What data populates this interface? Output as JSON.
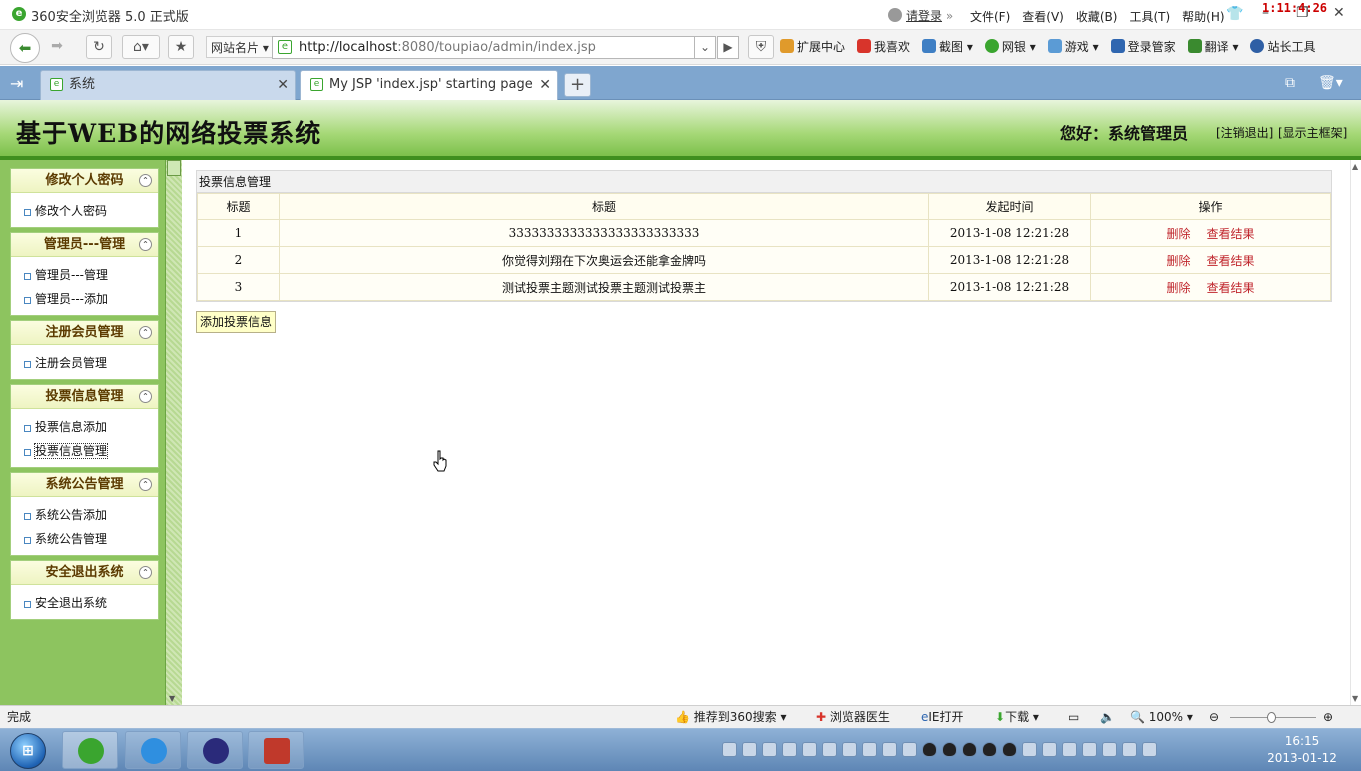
{
  "window": {
    "title": "360安全浏览器 5.0 正式版",
    "login_label": "请登录",
    "menu": [
      "文件(F)",
      "查看(V)",
      "收藏(B)",
      "工具(T)",
      "帮助(H)"
    ],
    "overlay_clock": "1:11:4:26",
    "minimize": "–",
    "restore": "❐",
    "close": "✕"
  },
  "navbar": {
    "site_cards": "网站名片 ▾",
    "url_host": "http://localhost",
    "url_rest": ":8080/toupiao/admin/index.jsp",
    "tools": [
      "扩展中心",
      "我喜欢",
      "截图",
      "网银",
      "游戏",
      "登录管家",
      "翻译",
      "站长工具"
    ]
  },
  "tabs": [
    {
      "label": "系统"
    },
    {
      "label": "My JSP 'index.jsp' starting page"
    }
  ],
  "header": {
    "site_title": "基于WEB的网络投票系统",
    "greeting": "您好：系统管理员",
    "logout_link": "[注销退出]",
    "frame_link": "[显示主框架]"
  },
  "sidebar": [
    {
      "title": "修改个人密码",
      "items": [
        "修改个人密码"
      ]
    },
    {
      "title": "管理员---管理",
      "items": [
        "管理员---管理",
        "管理员---添加"
      ]
    },
    {
      "title": "注册会员管理",
      "items": [
        "注册会员管理"
      ]
    },
    {
      "title": "投票信息管理",
      "items": [
        "投票信息添加",
        "投票信息管理"
      ]
    },
    {
      "title": "系统公告管理",
      "items": [
        "系统公告添加",
        "系统公告管理"
      ]
    },
    {
      "title": "安全退出系统",
      "items": [
        "安全退出系统"
      ]
    }
  ],
  "main": {
    "caption": "投票信息管理",
    "columns": [
      "标题",
      "标题",
      "发起时间",
      "操作"
    ],
    "rows": [
      {
        "id": "1",
        "title": "3333333333333333333333333",
        "time": "2013-1-08 12:21:28",
        "delete": "删除",
        "view": "查看结果"
      },
      {
        "id": "2",
        "title": "你觉得刘翔在下次奥运会还能拿金牌吗",
        "time": "2013-1-08 12:21:28",
        "delete": "删除",
        "view": "查看结果"
      },
      {
        "id": "3",
        "title": "测试投票主题测试投票主题测试投票主",
        "time": "2013-1-08 12:21:28",
        "delete": "删除",
        "view": "查看结果"
      }
    ],
    "add_button": "添加投票信息"
  },
  "statusbar": {
    "status": "完成",
    "recommend": "推荐到360搜索",
    "doctor": "浏览器医生",
    "ie_open": "IE打开",
    "download": "下载",
    "zoom": "100%"
  },
  "taskbar": {
    "time": "16:15",
    "date": "2013-01-12"
  },
  "colors": {
    "header_green": "#7cc04b",
    "link_red": "#c0262d",
    "sidebar_green": "#8dc45f"
  }
}
